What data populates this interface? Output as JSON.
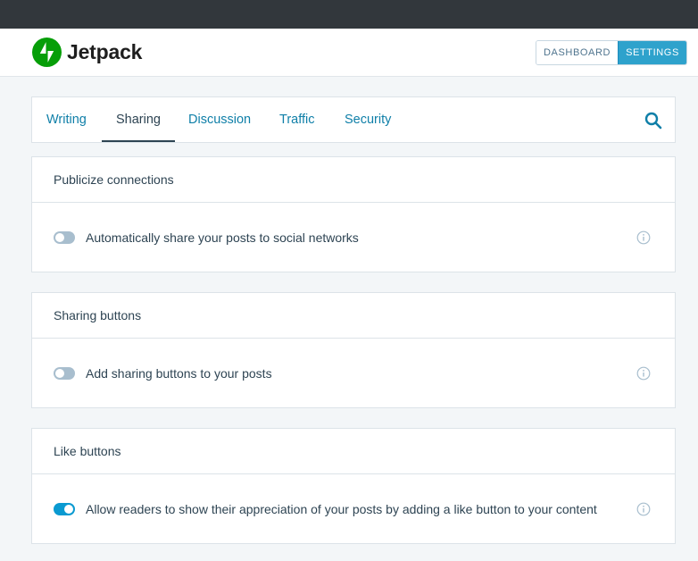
{
  "header": {
    "brand": "Jetpack",
    "nav": {
      "dashboard": "DASHBOARD",
      "settings": "SETTINGS",
      "active": "settings"
    }
  },
  "tabs": {
    "items": [
      {
        "label": "Writing"
      },
      {
        "label": "Sharing",
        "active": true
      },
      {
        "label": "Discussion"
      },
      {
        "label": "Traffic"
      },
      {
        "label": "Security"
      }
    ],
    "search_icon": "search-icon"
  },
  "cards": [
    {
      "title": "Publicize connections",
      "option": "Automatically share your posts to social networks",
      "enabled": false
    },
    {
      "title": "Sharing buttons",
      "option": "Add sharing buttons to your posts",
      "enabled": false
    },
    {
      "title": "Like buttons",
      "option": "Allow readers to show their appreciation of your posts by adding a like button to your content",
      "enabled": true
    }
  ],
  "colors": {
    "accent": "#2ea2cc",
    "link": "#0f7fa8",
    "toggle_on": "#0a9ad1",
    "toggle_off": "#a8bece",
    "jetpack_green": "#069e08"
  }
}
